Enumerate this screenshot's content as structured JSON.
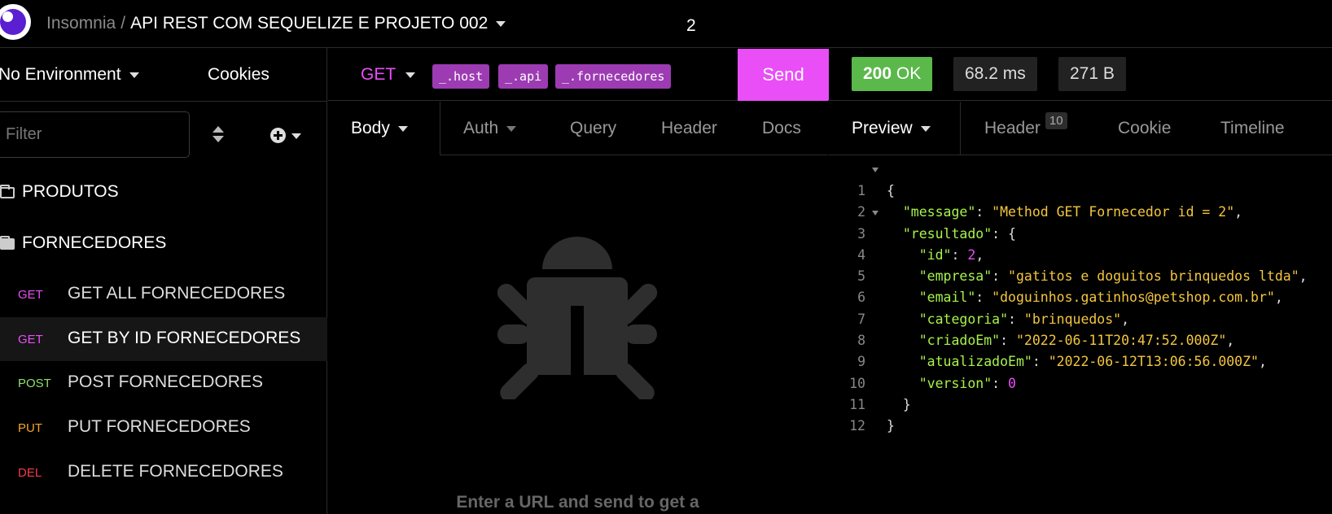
{
  "header": {
    "app_name": "Insomnia",
    "separator": "/",
    "project_name": "API REST COM SEQUELIZE E PROJETO 002"
  },
  "sidebar": {
    "environment": "No Environment",
    "cookies": "Cookies",
    "filter_placeholder": "Filter",
    "folders": [
      {
        "label": "PRODUTOS"
      },
      {
        "label": "FORNECEDORES"
      }
    ],
    "requests": [
      {
        "method": "GET",
        "label": "GET ALL FORNECEDORES"
      },
      {
        "method": "GET",
        "label": "GET BY ID FORNECEDORES"
      },
      {
        "method": "POST",
        "label": "POST FORNECEDORES"
      },
      {
        "method": "PUT",
        "label": "PUT FORNECEDORES"
      },
      {
        "method": "DEL",
        "label": "DELETE FORNECEDORES"
      }
    ],
    "active_request_index": 1
  },
  "request": {
    "method": "GET",
    "url_chips": [
      "_.host",
      "_.api",
      "_.fornecedores"
    ],
    "url_suffix": "2",
    "send_label": "Send",
    "tabs": [
      "Body",
      "Auth",
      "Query",
      "Header",
      "Docs"
    ],
    "empty_message": "Enter a URL and send to get a"
  },
  "response": {
    "status_code": "200",
    "status_text": "OK",
    "time": "68.2 ms",
    "size": "271 B",
    "tabs": {
      "preview": "Preview",
      "header": "Header",
      "header_count": "10",
      "cookie": "Cookie",
      "timeline": "Timeline"
    },
    "lines": [
      "1",
      "2",
      "3",
      "4",
      "5",
      "6",
      "7",
      "8",
      "9",
      "10",
      "11",
      "12"
    ],
    "json": {
      "open_brace": "{",
      "message_key": "\"message\"",
      "message_value": "\"Method GET Fornecedor id = 2\"",
      "resultado_key": "\"resultado\"",
      "id_key": "\"id\"",
      "id_value": "2",
      "empresa_key": "\"empresa\"",
      "empresa_value": "\"gatitos e doguitos brinquedos ltda\"",
      "email_key": "\"email\"",
      "email_value": "\"doguinhos.gatinhos@petshop.com.br\"",
      "categoria_key": "\"categoria\"",
      "categoria_value": "\"brinquedos\"",
      "criadoEm_key": "\"criadoEm\"",
      "criadoEm_value": "\"2022-06-11T20:47:52.000Z\"",
      "atualizadoEm_key": "\"atualizadoEm\"",
      "atualizadoEm_value": "\"2022-06-12T13:06:56.000Z\"",
      "version_key": "\"version\"",
      "version_value": "0",
      "inner_close": "}",
      "outer_close": "}"
    }
  },
  "colors": {
    "accent": "#e94ef7",
    "get": "#e94ef7",
    "post": "#8ee06a",
    "put": "#f5a623",
    "del": "#f53b4b",
    "status_ok": "#5bb84b",
    "json_key": "#a7f24a",
    "json_string": "#f3c63e"
  }
}
